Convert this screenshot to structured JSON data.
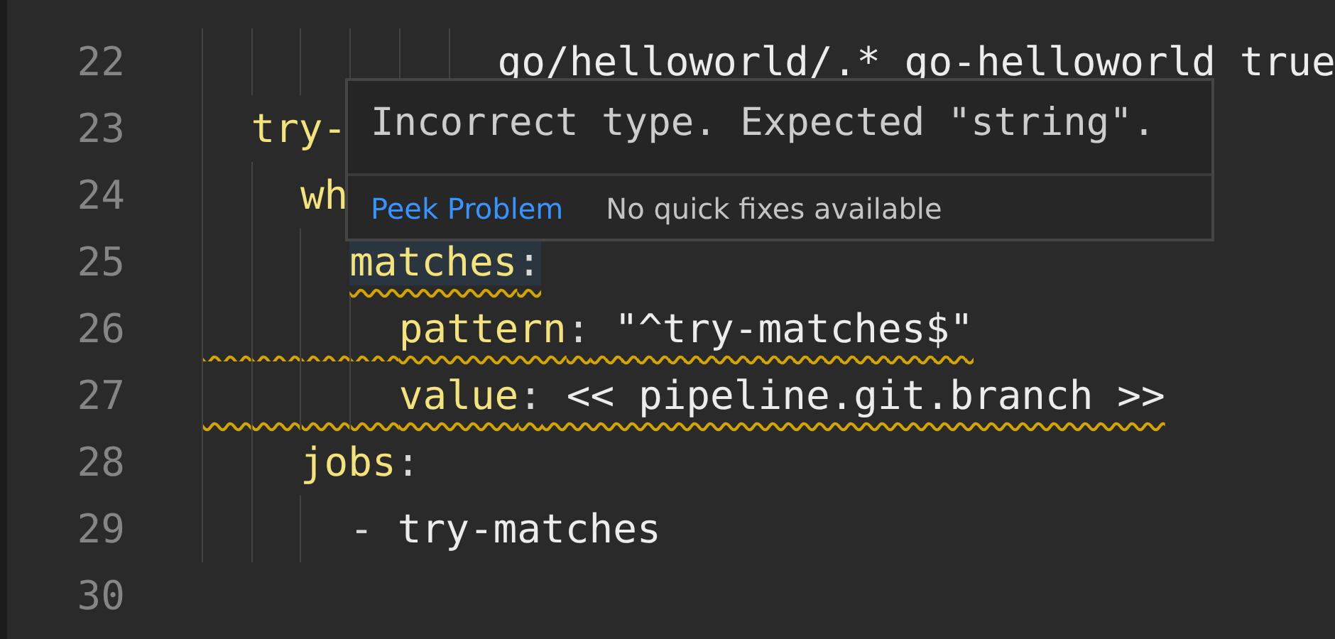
{
  "editor": {
    "lines": [
      {
        "children": [
          {
            "children": [
              {
                "children": [
                  {
                    "children": [
                      {
                        "children": [
                          {
                            "children": [
                              {
                                "number": "22",
                                "tokens": [
                                  {
                                    "kind": "plain",
                                    "text": "go/helloworld/.* go-helloworld true"
                                  }
                                ]
                              }
                            ]
                          }
                        ]
                      }
                    ]
                  }
                ]
              }
            ]
          },
          {
            "number": "23",
            "tokens": [
              {
                "kind": "key",
                "text": "try-"
              }
            ],
            "children": [
              {
                "number": "24",
                "tokens": [
                  {
                    "kind": "key",
                    "text": "wh"
                  }
                ],
                "children": [
                  {
                    "number": "25",
                    "highlighted": true,
                    "warning": true,
                    "tokens": [
                      {
                        "kind": "key",
                        "text": "matches"
                      },
                      {
                        "kind": "punct",
                        "text": ":"
                      }
                    ],
                    "children": [
                      {
                        "number": "26",
                        "warning": true,
                        "warning_from_margin": true,
                        "tokens": [
                          {
                            "kind": "key",
                            "text": "pattern"
                          },
                          {
                            "kind": "punct",
                            "text": ":"
                          },
                          {
                            "kind": "plain",
                            "text": " \"^try-matches$\""
                          }
                        ]
                      },
                      {
                        "number": "27",
                        "warning": true,
                        "warning_from_margin": true,
                        "tokens": [
                          {
                            "kind": "key",
                            "text": "value"
                          },
                          {
                            "kind": "punct",
                            "text": ":"
                          },
                          {
                            "kind": "plain",
                            "text": " << pipeline.git.branch >>"
                          }
                        ]
                      }
                    ]
                  }
                ]
              },
              {
                "number": "28",
                "tokens": [
                  {
                    "kind": "key",
                    "text": "jobs"
                  },
                  {
                    "kind": "punct",
                    "text": ":"
                  }
                ],
                "children": [
                  {
                    "number": "29",
                    "tokens": [
                      {
                        "kind": "punct",
                        "text": "- "
                      },
                      {
                        "kind": "plain",
                        "text": "try-matches"
                      }
                    ]
                  }
                ]
              }
            ]
          }
        ]
      },
      {
        "number": "30"
      }
    ]
  },
  "hover": {
    "message": "Incorrect type. Expected \"string\".",
    "action": "Peek Problem",
    "note": "No quick fixes available"
  }
}
